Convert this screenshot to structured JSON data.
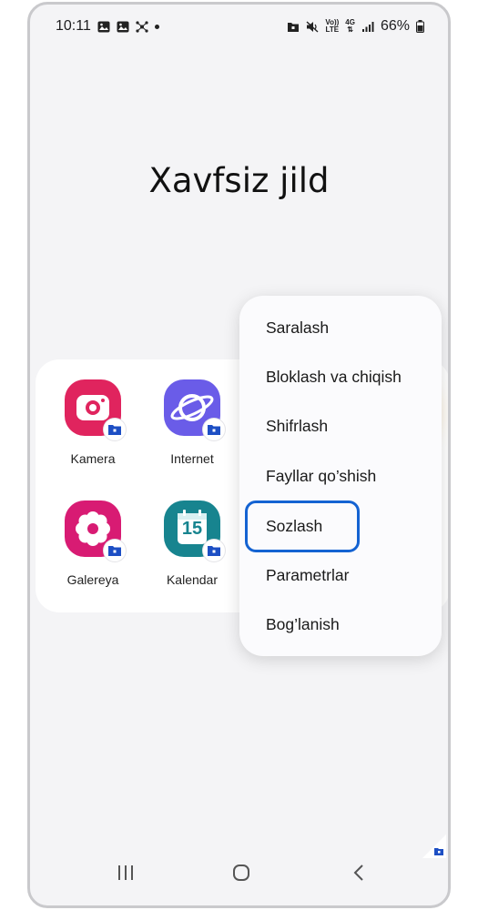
{
  "status_bar": {
    "time": "10:11",
    "battery": "66%",
    "network": "4G",
    "volte_line1": "Vo))",
    "volte_line2": "LTE"
  },
  "page": {
    "title": "Xavfsiz jild"
  },
  "apps": [
    {
      "label": "Kamera",
      "icon": "camera-icon",
      "color": "#e0245e"
    },
    {
      "label": "Internet",
      "icon": "internet-icon",
      "color": "#6a5ce8"
    },
    {
      "label": "Galereya",
      "icon": "gallery-icon",
      "color": "#d81b73"
    },
    {
      "label": "Kalendar",
      "icon": "calendar-icon",
      "color": "#17848f",
      "day": "15"
    }
  ],
  "menu": {
    "items": [
      "Saralash",
      "Bloklash va chiqish",
      "Shifrlash",
      "Fayllar qo’shish",
      "Sozlash",
      "Parametrlar",
      "Bog’lanish"
    ],
    "highlighted_index": 4
  },
  "colors": {
    "highlight": "#1463d2",
    "lock_badge": "#1d4fc4"
  }
}
